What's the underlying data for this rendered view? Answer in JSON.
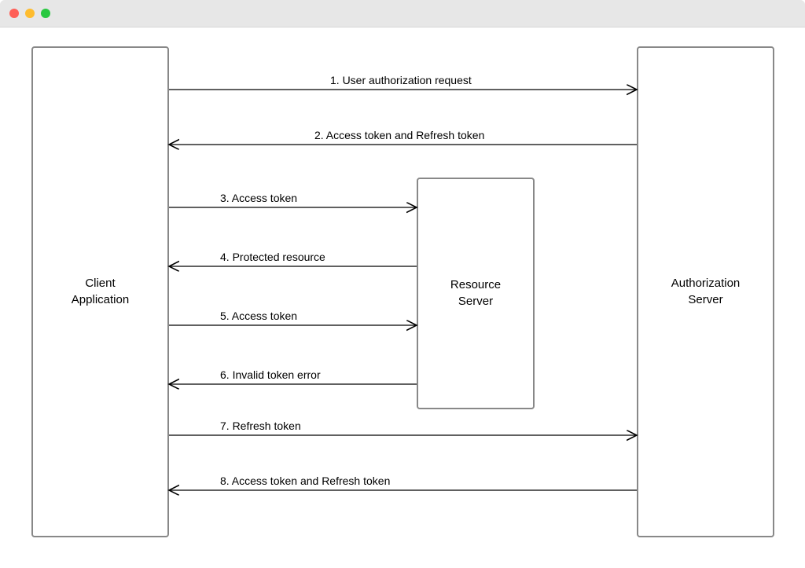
{
  "entities": {
    "client": "Client\nApplication",
    "auth": "Authorization\nServer",
    "resource": "Resource\nServer"
  },
  "messages": {
    "m1": "1. User authorization request",
    "m2": "2. Access token and Refresh token",
    "m3": "3. Access token",
    "m4": "4. Protected resource",
    "m5": "5. Access token",
    "m6": "6. Invalid token error",
    "m7": "7. Refresh token",
    "m8": "8. Access token and Refresh token"
  },
  "colors": {
    "border": "#888888",
    "arrow": "#000000",
    "titlebar": "#e7e7e7"
  }
}
